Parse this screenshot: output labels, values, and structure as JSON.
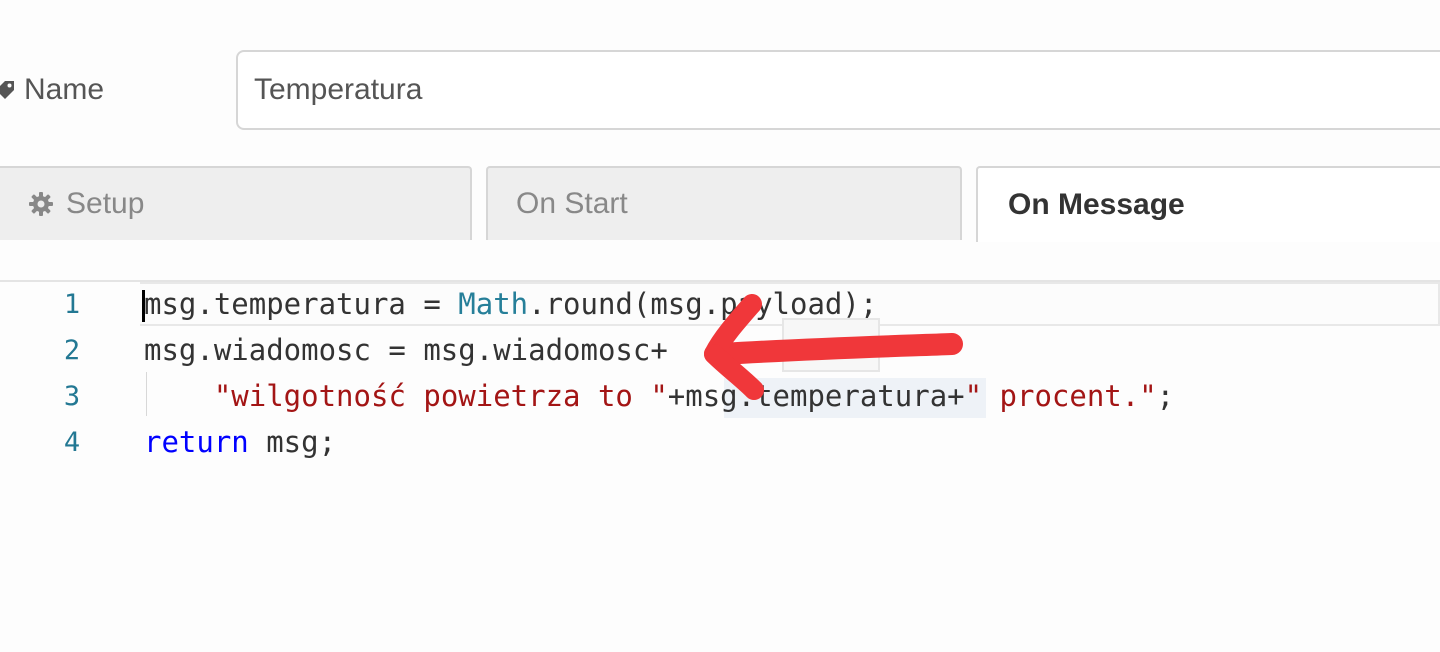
{
  "form": {
    "name_label": "Name",
    "name_value": "Temperatura"
  },
  "tabs": [
    {
      "label": "Setup",
      "icon": "gear-icon",
      "active": false
    },
    {
      "label": "On Start",
      "active": false
    },
    {
      "label": "On Message",
      "active": true
    }
  ],
  "editor": {
    "lines": [
      {
        "number": "1"
      },
      {
        "number": "2"
      },
      {
        "number": "3"
      },
      {
        "number": "4"
      }
    ],
    "tokens": {
      "l1_a": "msg.temperatura = ",
      "l1_b": "Math",
      "l1_c": ".round(msg.payload);",
      "l2_a": "msg.wiadomosc = msg.wiadomosc+",
      "l3_a": "    ",
      "l3_b": "\"wilgotność powietrza to \"",
      "l3_c": "+msg.temperatura+",
      "l3_d": "\" procent.\"",
      "l3_e": ";",
      "l4_a": "return",
      "l4_b": " msg;"
    }
  },
  "colors": {
    "annotation_arrow": "#f0373a",
    "keyword": "#0000ff",
    "type": "#267f99",
    "string": "#a31515",
    "line_number": "#237893"
  }
}
